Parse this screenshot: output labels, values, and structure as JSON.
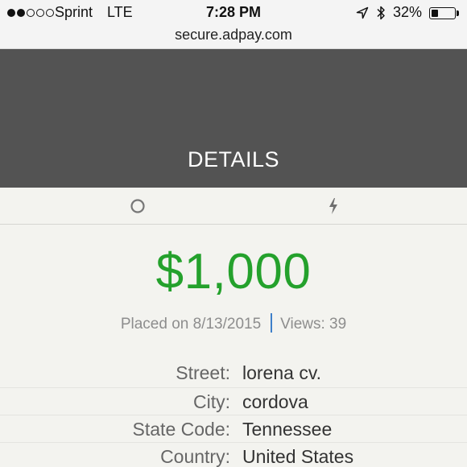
{
  "status_bar": {
    "carrier": "Sprint",
    "network": "LTE",
    "time": "7:28 PM",
    "battery_percent": "32%",
    "battery_level": 0.32,
    "signal_bars_filled": 2,
    "signal_bars_total": 5,
    "icons": [
      "location-arrow-icon",
      "bluetooth-icon",
      "battery-icon"
    ]
  },
  "browser": {
    "url": "secure.adpay.com"
  },
  "header": {
    "title": "DETAILS"
  },
  "tabs": [
    {
      "icon": "circle-icon"
    },
    {
      "icon": "lightning-bolt-icon"
    }
  ],
  "listing": {
    "price": "$1,000",
    "placed_on": "Placed on 8/13/2015",
    "views": "Views: 39",
    "accent_color": "#24a12c",
    "separator_color": "#3d7fc9"
  },
  "details": [
    {
      "label": "Street:",
      "value": "lorena cv."
    },
    {
      "label": "City:",
      "value": "cordova"
    },
    {
      "label": "State Code:",
      "value": "Tennessee"
    },
    {
      "label": "Country:",
      "value": "United States"
    }
  ]
}
